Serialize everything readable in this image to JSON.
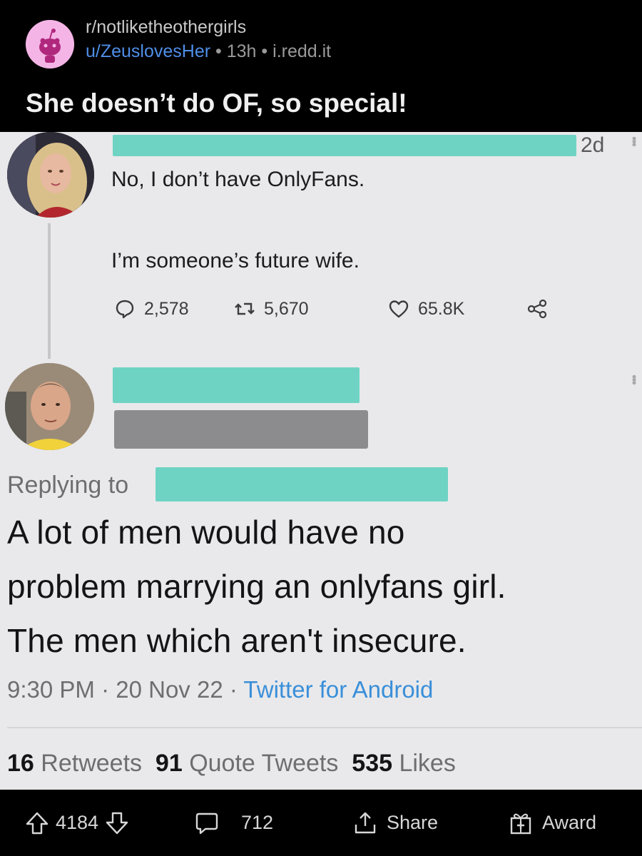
{
  "post": {
    "subreddit": "r/notliketheothergirls",
    "author": "u/ZeuslovesHer",
    "sep1": "•",
    "age": "13h",
    "sep2": "•",
    "domain": "i.redd.it",
    "title": "She doesn’t do OF, so special!"
  },
  "tweet1": {
    "time": "2d",
    "line1": "No, I don’t have OnlyFans.",
    "line2": "I’m someone’s future wife.",
    "replies": "2,578",
    "retweets": "5,670",
    "likes": "65.8K"
  },
  "tweet2": {
    "replying_to": "Replying to",
    "line1": "A lot of men would have no",
    "line2": "problem marrying an onlyfans girl.",
    "line3": "The men which aren't insecure.",
    "time": "9:30 PM",
    "dot1": " · ",
    "date": "20 Nov 22",
    "dot2": " · ",
    "source": "Twitter for Android",
    "retweets_count": "16",
    "retweets_label": "Retweets",
    "quotes_count": "91",
    "quotes_label": "Quote Tweets",
    "likes_count": "535",
    "likes_label": "Likes"
  },
  "footer": {
    "upvotes": "4184",
    "comments": "712",
    "share": "Share",
    "award": "Award"
  },
  "colors": {
    "redaction_teal": "#6fd3c4",
    "link_blue": "#4f8ee8",
    "twitter_blue": "#3a8fd9"
  }
}
